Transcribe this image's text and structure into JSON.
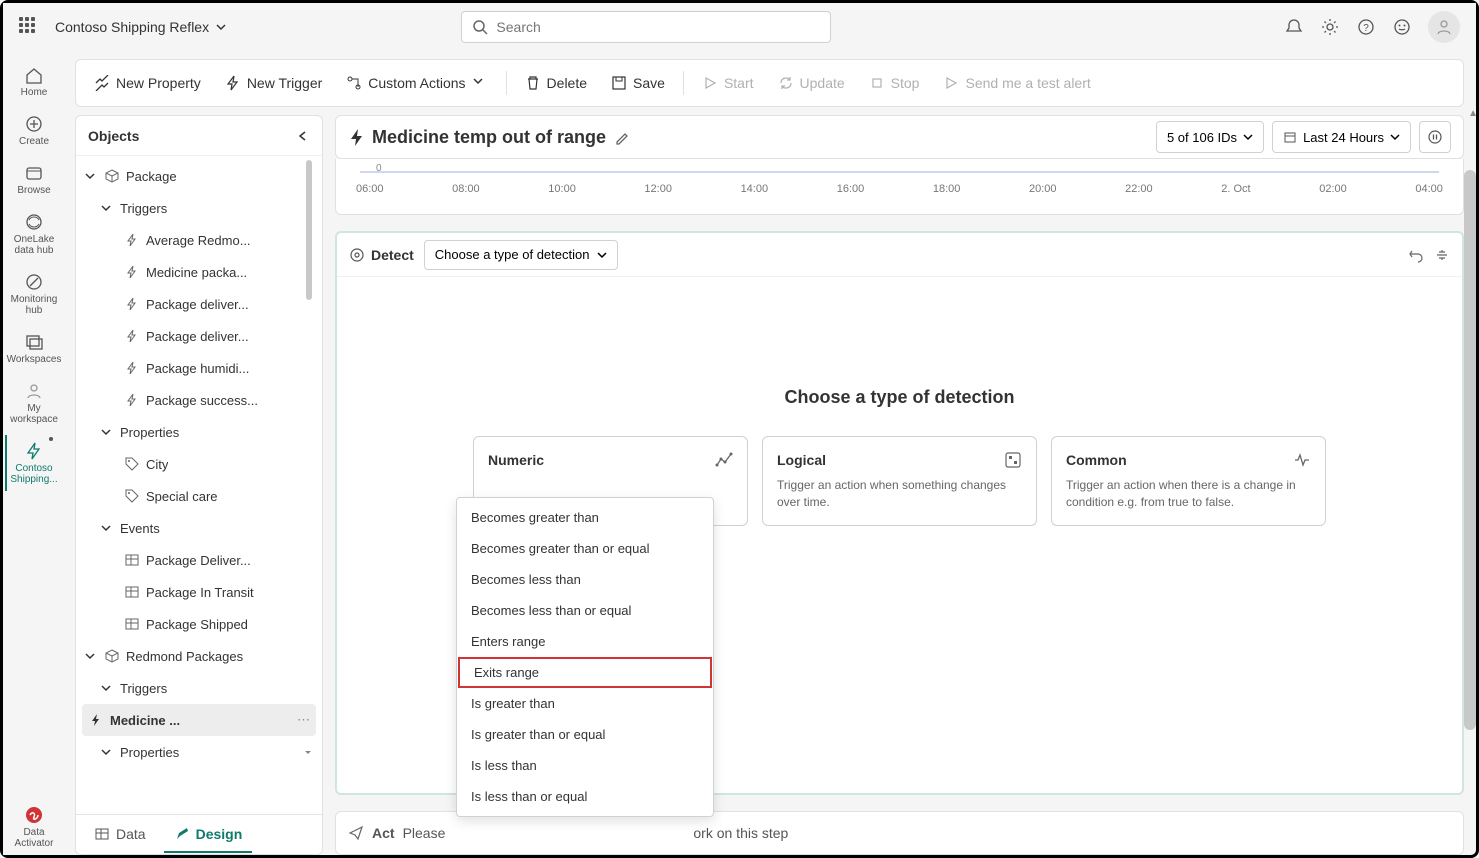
{
  "app": {
    "name": "Contoso Shipping Reflex"
  },
  "search": {
    "placeholder": "Search"
  },
  "leftrail": {
    "home": "Home",
    "create": "Create",
    "browse": "Browse",
    "onelake": "OneLake data hub",
    "monitoring": "Monitoring hub",
    "workspaces": "Workspaces",
    "myworkspace": "My workspace",
    "active": "Contoso Shipping...",
    "activator": "Data Activator"
  },
  "toolbar": {
    "newprop": "New Property",
    "newtrigger": "New Trigger",
    "custom": "Custom Actions",
    "delete": "Delete",
    "save": "Save",
    "start": "Start",
    "update": "Update",
    "stop": "Stop",
    "sendtest": "Send me a test alert"
  },
  "objects": {
    "title": "Objects",
    "package": "Package",
    "triggers": "Triggers",
    "trigger_items": [
      "Average Redmo...",
      "Medicine packa...",
      "Package deliver...",
      "Package deliver...",
      "Package humidi...",
      "Package success..."
    ],
    "properties": "Properties",
    "property_items": [
      "City",
      "Special care"
    ],
    "events": "Events",
    "event_items": [
      "Package Deliver...",
      "Package In Transit",
      "Package Shipped"
    ],
    "redmond": "Redmond Packages",
    "redmond_triggers": "Triggers",
    "selected_trigger": "Medicine ...",
    "redmond_properties": "Properties",
    "tabs": {
      "data": "Data",
      "design": "Design"
    }
  },
  "canvas": {
    "title": "Medicine temp out of range",
    "ids": "5 of 106 IDs",
    "timerange": "Last 24 Hours"
  },
  "timeline": {
    "zero": "0",
    "ticks": [
      "06:00",
      "08:00",
      "10:00",
      "12:00",
      "14:00",
      "16:00",
      "18:00",
      "20:00",
      "22:00",
      "2. Oct",
      "02:00",
      "04:00"
    ]
  },
  "detect": {
    "label": "Detect",
    "dropdown": "Choose a type of detection",
    "prompt": "Choose a type of detection",
    "cards": {
      "numeric": {
        "title": "Numeric"
      },
      "logical": {
        "title": "Logical",
        "desc": "Trigger an action when something changes over time."
      },
      "common": {
        "title": "Common",
        "desc": "Trigger an action when there is a change in condition e.g. from true to false."
      }
    }
  },
  "numeric_menu": [
    "Becomes greater than",
    "Becomes greater than or equal",
    "Becomes less than",
    "Becomes less than or equal",
    "Enters range",
    "Exits range",
    "Is greater than",
    "Is greater than or equal",
    "Is less than",
    "Is less than or equal"
  ],
  "act": {
    "label": "Act",
    "text_before": "Please",
    "text_after": "ork on this step"
  }
}
